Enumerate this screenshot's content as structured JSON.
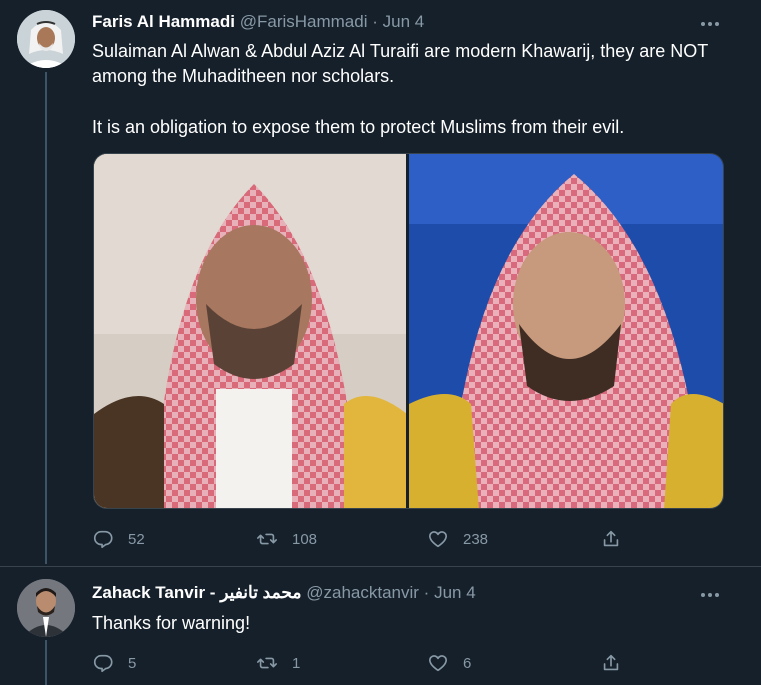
{
  "tweets": [
    {
      "author_name": "Faris Al Hammadi",
      "author_handle": "@FarisHammadi",
      "separator": "·",
      "date": "Jun 4",
      "text_line1": "Sulaiman Al Alwan & Abdul Aziz Al Turaifi are modern Khawarij, they are NOT among the Muhaditheen nor scholars.",
      "text_line2": "It is an obligation to expose them to protect Muslims from their evil.",
      "replies": "52",
      "retweets": "108",
      "likes": "238",
      "icons": [
        "more-icon",
        "reply-icon",
        "retweet-icon",
        "like-icon",
        "share-icon"
      ]
    },
    {
      "author_name": "Zahack Tanvir - محمد تانفير",
      "author_handle": "@zahacktanvir",
      "separator": "·",
      "date": "Jun 4",
      "text": "Thanks for warning!",
      "replies": "5",
      "retweets": "1",
      "likes": "6"
    }
  ],
  "colors": {
    "background": "#15202b",
    "secondary_text": "#8899a6",
    "primary_text": "#ffffff",
    "divider": "#38444d"
  }
}
